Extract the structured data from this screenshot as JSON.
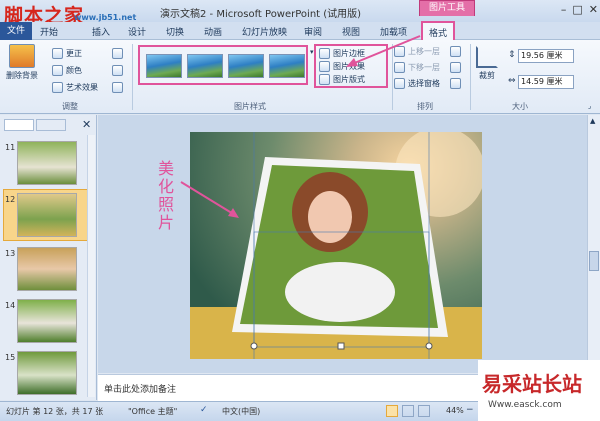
{
  "window": {
    "title": "演示文稿2 - Microsoft PowerPoint (试用版)",
    "context_tab_group": "图片工具",
    "controls": [
      "–",
      "□",
      "✕"
    ]
  },
  "watermark": {
    "logo": "脚本之家",
    "url": "www.jb51.net",
    "corner_logo": "易采站长站",
    "corner_url": "Www.easck.com"
  },
  "tabs": [
    {
      "label": "文件"
    },
    {
      "label": "开始"
    },
    {
      "label": "插入"
    },
    {
      "label": "设计"
    },
    {
      "label": "切换"
    },
    {
      "label": "动画"
    },
    {
      "label": "幻灯片放映"
    },
    {
      "label": "审阅"
    },
    {
      "label": "视图"
    },
    {
      "label": "加载项"
    },
    {
      "label": "格式"
    }
  ],
  "ribbon": {
    "adjust": {
      "label": "调整",
      "remove_bg": "删除背景",
      "correct": "更正",
      "color": "颜色",
      "artistic": "艺术效果"
    },
    "picture_styles": {
      "label": "图片样式",
      "border": "图片边框",
      "effects": "图片效果",
      "layout": "图片版式"
    },
    "arrange": {
      "label": "排列",
      "bring_forward": "上移一层",
      "send_backward": "下移一层",
      "selection_pane": "选择窗格"
    },
    "size": {
      "label": "大小",
      "crop": "裁剪",
      "height": "19.56 厘米",
      "width": "14.59 厘米"
    }
  },
  "slides_pane": {
    "numbers": [
      "11",
      "12",
      "13",
      "14",
      "15"
    ]
  },
  "callout": {
    "text": "美化照片"
  },
  "notes": {
    "placeholder": "单击此处添加备注"
  },
  "status": {
    "slide_info": "幻灯片 第 12 张，共 17 张",
    "theme": "\"Office 主题\"",
    "language": "中文(中国)",
    "zoom": "44%"
  },
  "colors": {
    "accent": "#e0549b",
    "ribbon_blue": "#1e395b"
  }
}
